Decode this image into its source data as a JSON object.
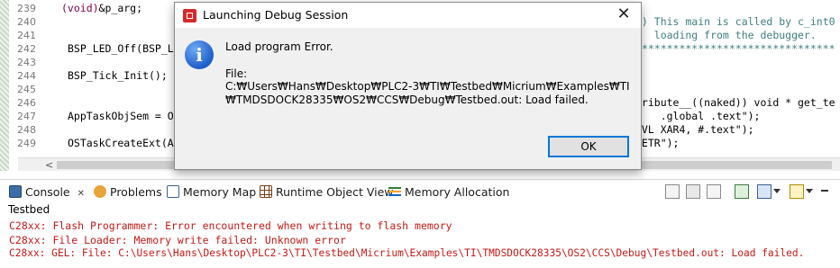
{
  "editor": {
    "lines": [
      {
        "num": "239",
        "code": "(void)&p_arg;"
      },
      {
        "num": "240",
        "code": ""
      },
      {
        "num": "241",
        "code": ""
      },
      {
        "num": "242",
        "code": "BSP_LED_Off(BSP_L"
      },
      {
        "num": "243",
        "code": ""
      },
      {
        "num": "244",
        "code": "BSP_Tick_Init();"
      },
      {
        "num": "245",
        "code": ""
      },
      {
        "num": "246",
        "code": ""
      },
      {
        "num": "247",
        "code": "AppTaskObjSem = O"
      },
      {
        "num": "248",
        "code": ""
      },
      {
        "num": "249",
        "code": "OSTaskCreateExt(A"
      }
    ],
    "right_lines": [
      "1) This main is called by c_int0",
      "   loading from the debugger.",
      "********************************",
      "",
      "",
      "",
      "tribute__((naked)) void * get_te",
      "    .global .text\");",
      "OVL XAR4, #.text\");",
      "RETR\");"
    ],
    "scroll_left": "<"
  },
  "dialog": {
    "title": "Launching Debug Session",
    "close": "✕",
    "message_title": "Load program Error.",
    "file_label": "File:",
    "file_path": "C:₩Users₩Hans₩Desktop₩PLC2-3₩TI₩Testbed₩Micrium₩Examples₩TI₩TMDSDOCK28335₩OS2₩CCS₩Debug₩Testbed.out: Load failed.",
    "ok_label": "OK",
    "info_glyph": "i"
  },
  "views": {
    "tabs": [
      {
        "label": "Console",
        "close": "✕"
      },
      {
        "label": "Problems"
      },
      {
        "label": "Memory Map"
      },
      {
        "label": "Runtime Object View"
      },
      {
        "label": "Memory Allocation"
      }
    ]
  },
  "console": {
    "name": "Testbed",
    "lines": [
      "C28xx: Flash Programmer: Error encountered when writing to flash memory",
      "C28xx: File Loader: Memory write failed: Unknown error",
      "C28xx: GEL: File: C:\\Users\\Hans\\Desktop\\PLC2-3\\TI\\Testbed\\Micrium\\Examples\\TI\\TMDSDOCK28335\\OS2\\CCS\\Debug\\Testbed.out: Load failed."
    ]
  },
  "colors": {
    "error_text": "#c41a16",
    "keyword": "#7f0055",
    "comment": "#3f7f7f",
    "accent": "#0078d7"
  }
}
